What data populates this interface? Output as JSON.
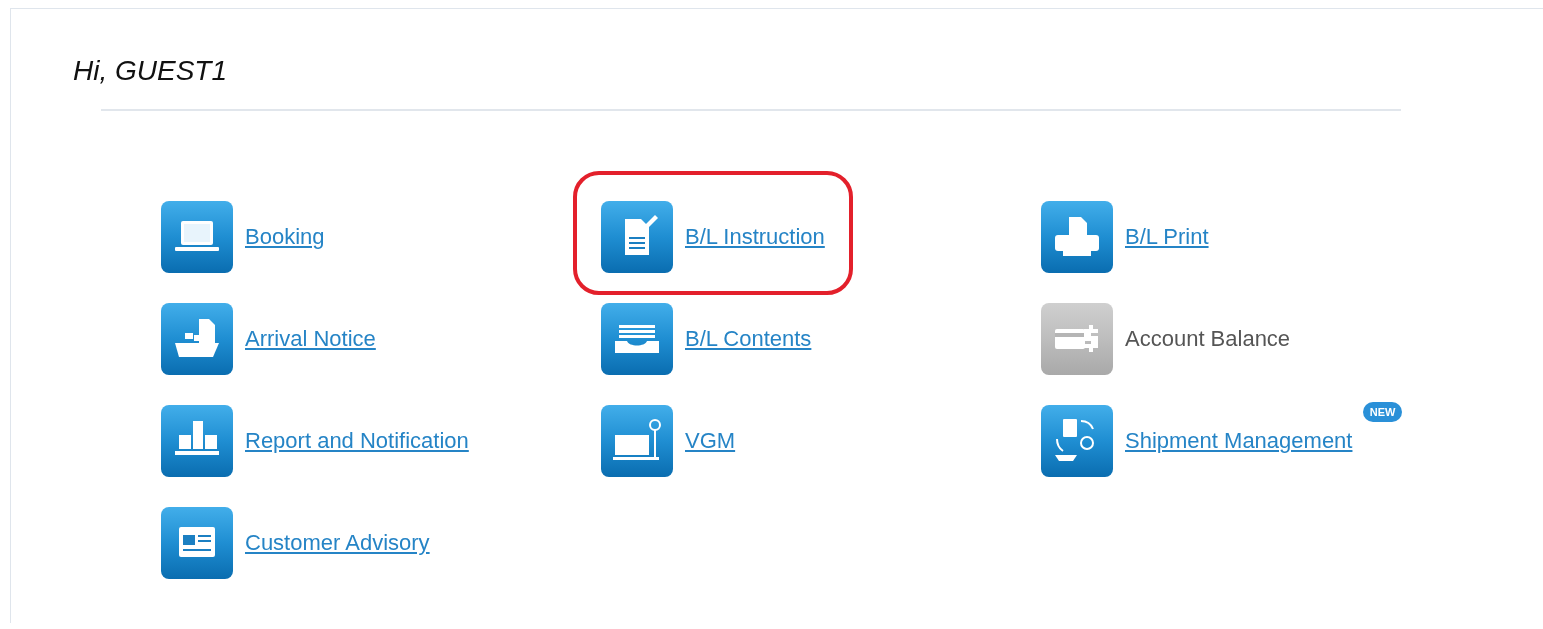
{
  "greeting": "Hi, GUEST1",
  "menu_items": [
    {
      "label": "Booking",
      "disabled": false,
      "highlighted": false
    },
    {
      "label": "B/L Instruction",
      "disabled": false,
      "highlighted": true
    },
    {
      "label": "B/L Print",
      "disabled": false,
      "highlighted": false
    },
    {
      "label": "Arrival Notice",
      "disabled": false,
      "highlighted": false
    },
    {
      "label": "B/L Contents",
      "disabled": false,
      "highlighted": false
    },
    {
      "label": "Account Balance",
      "disabled": true,
      "highlighted": false
    },
    {
      "label": "Report and Notification",
      "disabled": false,
      "highlighted": false
    },
    {
      "label": "VGM",
      "disabled": false,
      "highlighted": false
    },
    {
      "label": "Shipment Management",
      "disabled": false,
      "highlighted": false,
      "badge": "NEW"
    },
    {
      "label": "Customer Advisory",
      "disabled": false,
      "highlighted": false
    }
  ]
}
